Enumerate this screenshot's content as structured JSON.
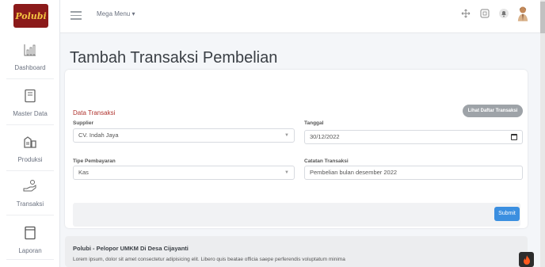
{
  "logo": {
    "text": "Polubi"
  },
  "sidebar": {
    "items": [
      {
        "label": "Dashboard",
        "icon": "chart-icon"
      },
      {
        "label": "Master Data",
        "icon": "document-icon"
      },
      {
        "label": "Produksi",
        "icon": "factory-icon"
      },
      {
        "label": "Transaksi",
        "icon": "hand-coins-icon"
      },
      {
        "label": "Laporan",
        "icon": "report-icon"
      }
    ]
  },
  "topbar": {
    "mega_menu": "Mega Menu ▾"
  },
  "page": {
    "title": "Tambah Transaksi Pembelian"
  },
  "form": {
    "section_title": "Data Transaksi",
    "list_button": "Lihat Daftar Transaksi",
    "supplier": {
      "label": "Supplier",
      "value": "CV. Indah Jaya"
    },
    "tanggal": {
      "label": "Tanggal",
      "value": "30/12/2022"
    },
    "tipe": {
      "label": "Tipe Pembayaran",
      "value": "Kas"
    },
    "catatan": {
      "label": "Catatan Transaksi",
      "value": "Pembelian bulan desember 2022"
    },
    "submit": "Submit"
  },
  "info": {
    "title": "Polubi - Pelopor UMKM Di Desa Cijayanti",
    "text": "Lorem ipsum, dolor sit amet consectetur adipisicing elit. Libero quis beatae officia saepe perferendis voluptatum minima"
  },
  "colors": {
    "accent": "#3b8fe0",
    "section_title": "#b0342f",
    "logo_bg": "#8b1a1a"
  }
}
